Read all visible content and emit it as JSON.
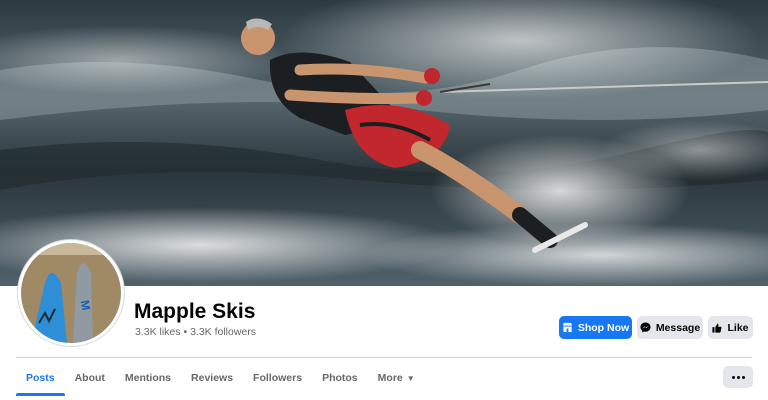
{
  "page": {
    "name": "Mapple Skis",
    "likes": "3.3K likes",
    "separator": "•",
    "followers": "3.3K followers"
  },
  "actions": {
    "shop_now": "Shop Now",
    "message": "Message",
    "like": "Like"
  },
  "tabs": [
    {
      "label": "Posts",
      "active": true
    },
    {
      "label": "About"
    },
    {
      "label": "Mentions"
    },
    {
      "label": "Reviews"
    },
    {
      "label": "Followers"
    },
    {
      "label": "Photos"
    },
    {
      "label": "More"
    }
  ],
  "icons": {
    "shop": "storefront-icon",
    "message": "messenger-icon",
    "like": "thumbs-up-icon",
    "more_caret": "caret-down-icon",
    "overflow": "ellipsis-icon"
  },
  "colors": {
    "accent": "#1877f2",
    "secondary_button": "#e4e6eb",
    "muted_text": "#65676b"
  }
}
